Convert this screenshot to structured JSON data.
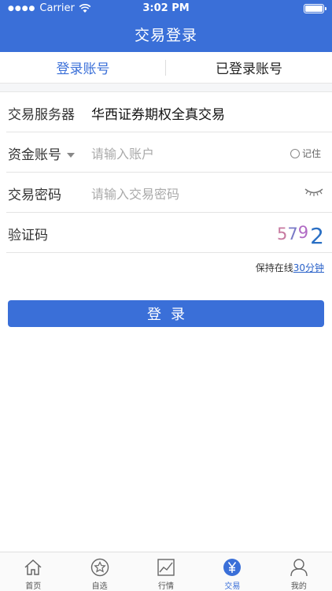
{
  "status_bar": {
    "carrier": "Carrier",
    "time": "3:02 PM"
  },
  "nav": {
    "title": "交易登录"
  },
  "tabs": [
    {
      "label": "登录账号",
      "active": true
    },
    {
      "label": "已登录账号",
      "active": false
    }
  ],
  "form": {
    "server": {
      "label": "交易服务器",
      "value": "华西证券期权全真交易"
    },
    "account": {
      "label": "资金账号",
      "placeholder": "请输入账户",
      "remember_label": "记住"
    },
    "password": {
      "label": "交易密码",
      "placeholder": "请输入交易密码"
    },
    "captcha": {
      "label": "验证码",
      "digits": [
        "5",
        "7",
        "9",
        "2"
      ]
    }
  },
  "keep_online": {
    "prefix": "保持在线",
    "link": "30分钟"
  },
  "login_button": {
    "label": "登录"
  },
  "tabbar": [
    {
      "label": "首页",
      "icon": "home-icon"
    },
    {
      "label": "自选",
      "icon": "star-icon"
    },
    {
      "label": "行情",
      "icon": "chart-icon"
    },
    {
      "label": "交易",
      "icon": "yen-icon",
      "active": true
    },
    {
      "label": "我的",
      "icon": "person-icon"
    }
  ],
  "colors": {
    "brand": "#3a6fd8",
    "link": "#2a62c9"
  }
}
